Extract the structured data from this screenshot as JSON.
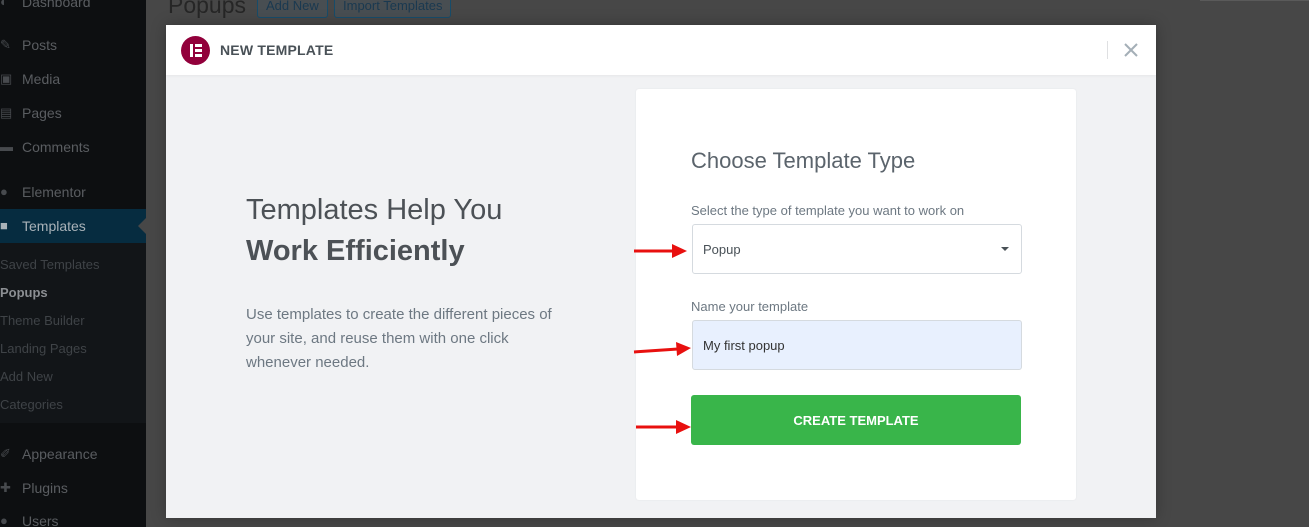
{
  "sidebar": {
    "items": [
      {
        "label": "Dashboard",
        "icon": "dashboard-icon"
      },
      {
        "label": "Posts",
        "icon": "pin-icon"
      },
      {
        "label": "Media",
        "icon": "media-icon"
      },
      {
        "label": "Pages",
        "icon": "page-icon"
      },
      {
        "label": "Comments",
        "icon": "comment-icon"
      },
      {
        "label": "Elementor",
        "icon": "elementor-icon"
      },
      {
        "label": "Templates",
        "icon": "folder-icon"
      },
      {
        "label": "Appearance",
        "icon": "brush-icon"
      },
      {
        "label": "Plugins",
        "icon": "plug-icon"
      },
      {
        "label": "Users",
        "icon": "user-icon"
      }
    ],
    "submenu": [
      "Saved Templates",
      "Popups",
      "Theme Builder",
      "Landing Pages",
      "Add New",
      "Categories"
    ]
  },
  "page": {
    "title": "Popups",
    "add_new_label": "Add New",
    "import_label": "Import Templates"
  },
  "modal": {
    "title": "NEW TEMPLATE",
    "logo_icon": "elementor-logo-icon",
    "close_icon": "close-icon",
    "intro": {
      "title": "Templates Help You",
      "title_strong": "Work Efficiently",
      "text": "Use templates to create the different pieces of your site, and reuse them with one click whenever needed."
    },
    "form": {
      "title": "Choose Template Type",
      "type_label": "Select the type of template you want to work on",
      "type_value": "Popup",
      "name_label": "Name your template",
      "name_value": "My first popup",
      "submit_label": "CREATE TEMPLATE"
    }
  },
  "colors": {
    "brand": "#92003b",
    "primary_button": "#39b54a",
    "annotation_arrow": "#e8100f"
  }
}
